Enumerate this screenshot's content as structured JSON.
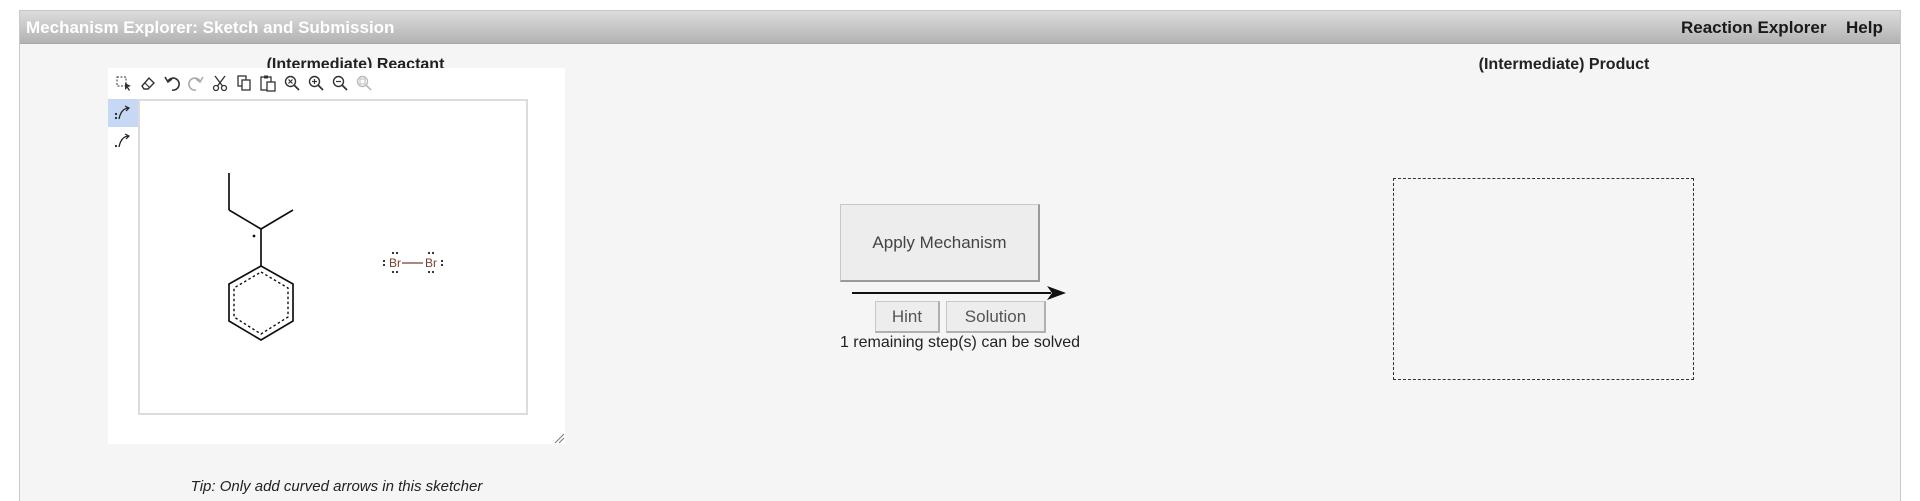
{
  "header": {
    "title": "Mechanism Explorer: Sketch and Submission",
    "links": [
      "Reaction Explorer",
      "Help"
    ]
  },
  "reactant": {
    "title": "(Intermediate) Reactant",
    "toolbar_icons": [
      "select-icon",
      "eraser-icon",
      "undo-icon",
      "redo-icon",
      "cut-icon",
      "copy-icon",
      "paste-icon",
      "zoom-reset-icon",
      "zoom-in-icon",
      "zoom-out-icon",
      "zoom-fit-icon"
    ],
    "side_tools": [
      "curved-arrow-pair-icon",
      "curved-arrow-single-icon"
    ],
    "molecule_labels": {
      "br_left": "Br",
      "br_right": "Br"
    },
    "tip": "Tip: Only add curved arrows in this sketcher"
  },
  "actions": {
    "apply_label": "Apply Mechanism",
    "hint_label": "Hint",
    "solution_label": "Solution",
    "status": "1 remaining step(s) can be solved"
  },
  "product": {
    "title": "(Intermediate) Product"
  }
}
